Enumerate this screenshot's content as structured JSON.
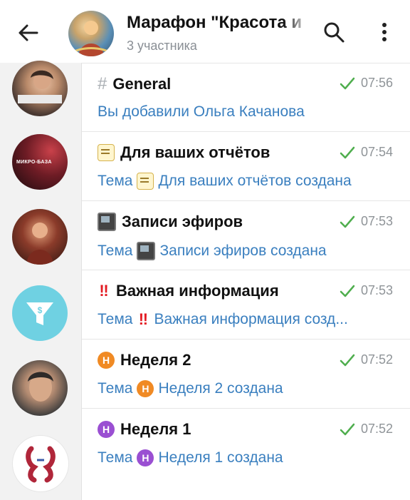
{
  "header": {
    "title": "Марафон \"Красота и",
    "subtitle": "3 участника",
    "back_icon": "arrow-left-icon",
    "search_icon": "search-icon",
    "menu_icon": "more-vert-icon"
  },
  "left_column": {
    "avatars": [
      "avatar-woman-book",
      "avatar-mikro-baza",
      "avatar-red-figure",
      "avatar-funnel-dollar",
      "avatar-woman-portrait",
      "avatar-logo"
    ],
    "avatar2_text": "МИКРО-БАЗА"
  },
  "topics": [
    {
      "icon": "hash-icon",
      "icon_text": "#",
      "title": "General",
      "time": "07:56",
      "message": "Вы добавили Ольга Качанова"
    },
    {
      "icon": "memo-icon",
      "title": "Для ваших отчётов",
      "time": "07:54",
      "message_prefix": "Тема",
      "message_rest": "Для ваших отчётов создана"
    },
    {
      "icon": "tv-icon",
      "title": "Записи эфиров",
      "time": "07:53",
      "message_prefix": "Тема",
      "message_rest": "Записи эфиров создана"
    },
    {
      "icon": "double-exclamation-icon",
      "icon_text": "‼",
      "title": "Важная информация",
      "time": "07:53",
      "message_prefix": "Тема",
      "message_rest": "Важная информация созд..."
    },
    {
      "icon": "h-circle-orange-icon",
      "icon_text": "Н",
      "title": "Неделя 2",
      "time": "07:52",
      "message_prefix": "Тема",
      "message_rest": "Неделя 2 создана"
    },
    {
      "icon": "h-circle-purple-icon",
      "icon_text": "Н",
      "title": "Неделя 1",
      "time": "07:52",
      "message_prefix": "Тема",
      "message_rest": "Неделя 1 создана"
    }
  ],
  "colors": {
    "link": "#3a7fbf",
    "check": "#4fae4e",
    "accent_orange": "#f08a24",
    "accent_purple": "#9a4fd2"
  }
}
